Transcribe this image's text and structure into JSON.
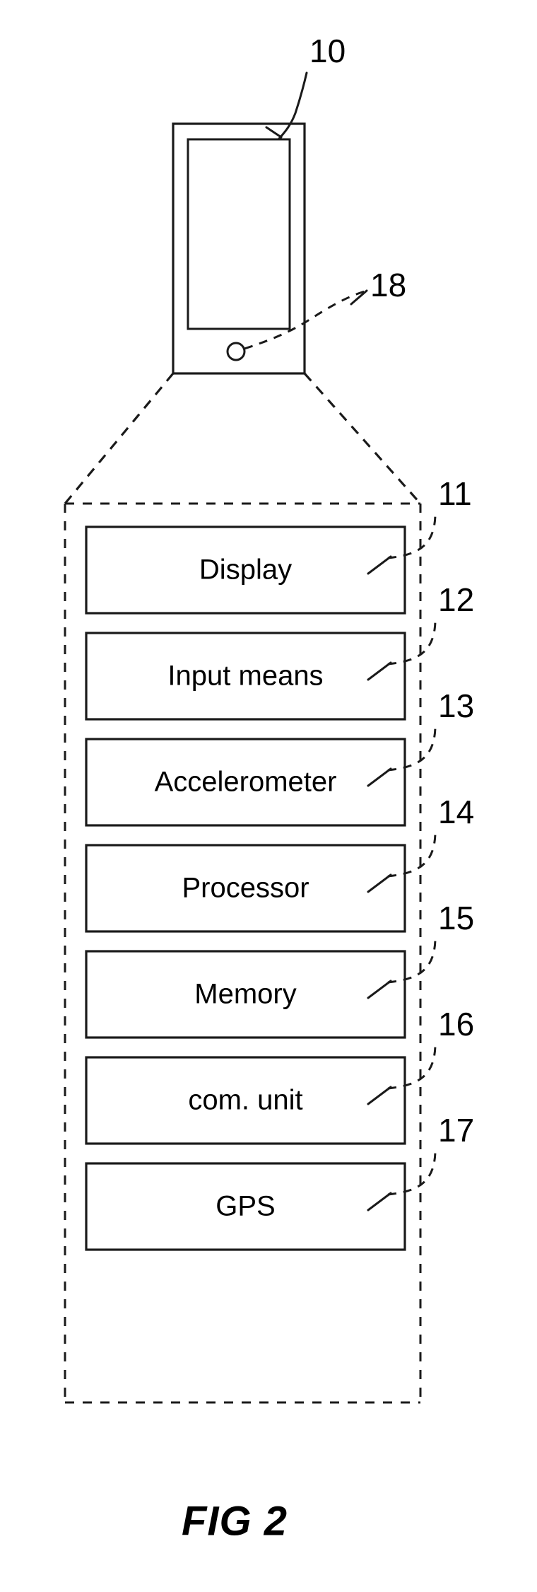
{
  "figure": {
    "caption": "FIG 2",
    "device_label": "10",
    "sensor_label": "18"
  },
  "blocks": [
    {
      "label": "Display",
      "ref": "11"
    },
    {
      "label": "Input means",
      "ref": "12"
    },
    {
      "label": "Accelerometer",
      "ref": "13"
    },
    {
      "label": "Processor",
      "ref": "14"
    },
    {
      "label": "Memory",
      "ref": "15"
    },
    {
      "label": "com. unit",
      "ref": "16"
    },
    {
      "label": "GPS",
      "ref": "17"
    }
  ],
  "colors": {
    "ink": "#1a1a1a",
    "background": "#ffffff"
  }
}
